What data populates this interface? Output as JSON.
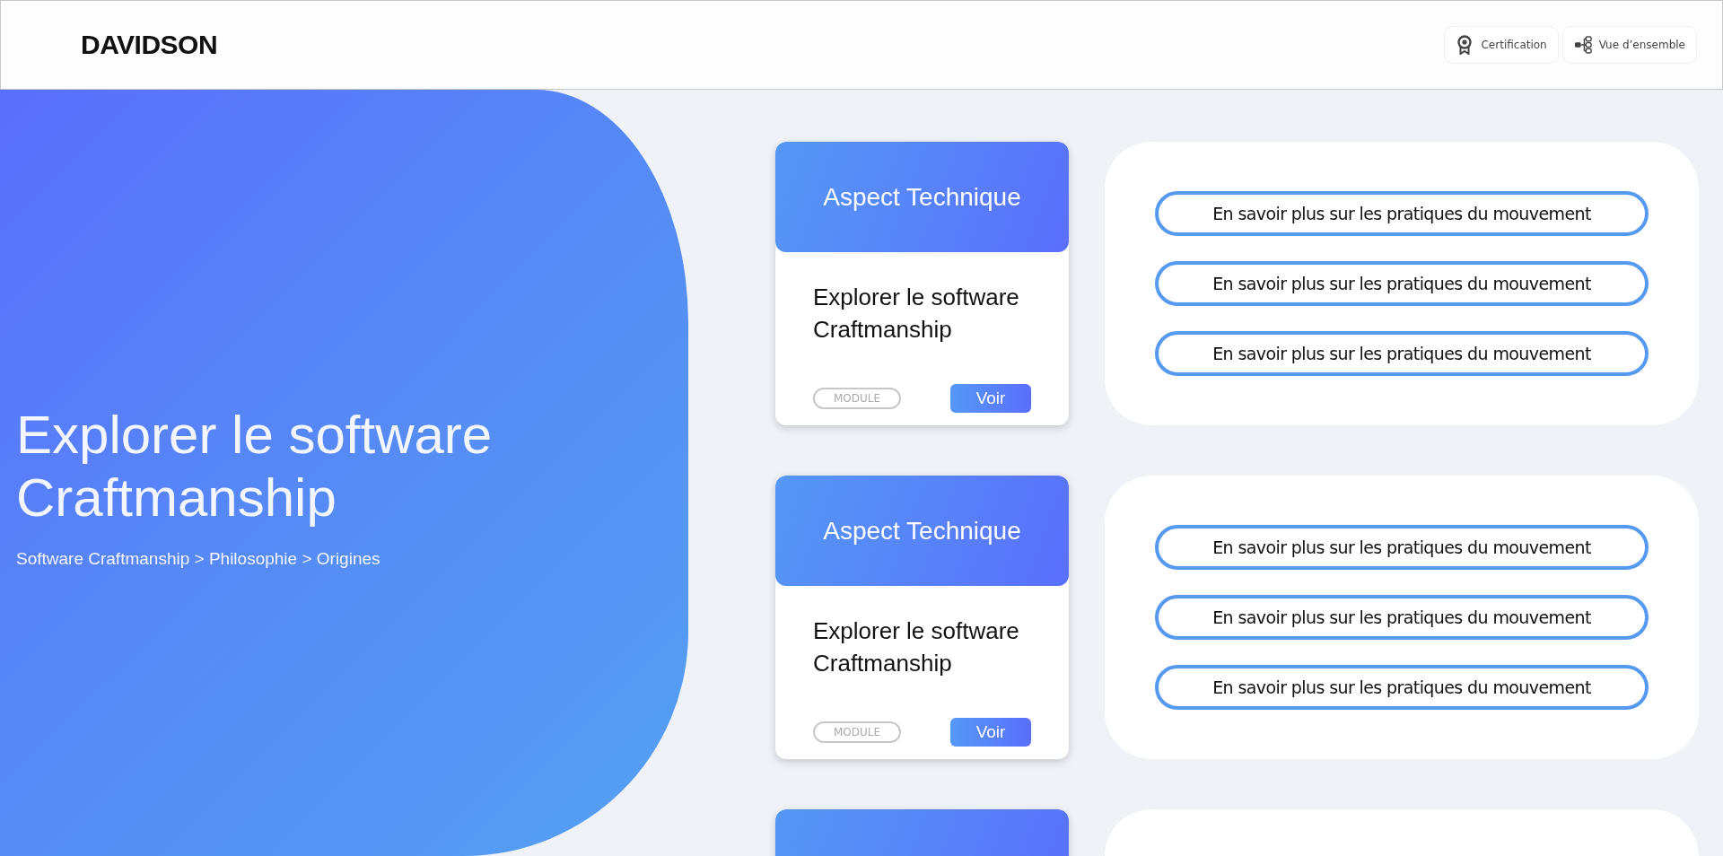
{
  "header": {
    "logo": "DAVIDSON",
    "nav": [
      {
        "label": "Certification"
      },
      {
        "label": "Vue d’ensemble"
      }
    ]
  },
  "hero": {
    "title": "Explorer le software Craftmanship",
    "breadcrumb": "Software Craftmanship > Philosophie > Origines"
  },
  "modules": [
    {
      "kind": "full",
      "header": "Aspect Technique",
      "title": "Explorer le software Craftmanship",
      "tag": "MODULE",
      "button": "Voir",
      "links": [
        "En savoir plus sur les pratiques du mouvement",
        "En savoir plus sur les pratiques du mouvement",
        "En savoir plus sur les pratiques du mouvement"
      ]
    },
    {
      "kind": "full",
      "header": "Aspect Technique",
      "title": "Explorer le software Craftmanship",
      "tag": "MODULE",
      "button": "Voir",
      "links": [
        "En savoir plus sur les pratiques du mouvement",
        "En savoir plus sur les pratiques du mouvement",
        "En savoir plus sur les pratiques du mouvement"
      ]
    },
    {
      "kind": "cut"
    }
  ]
}
